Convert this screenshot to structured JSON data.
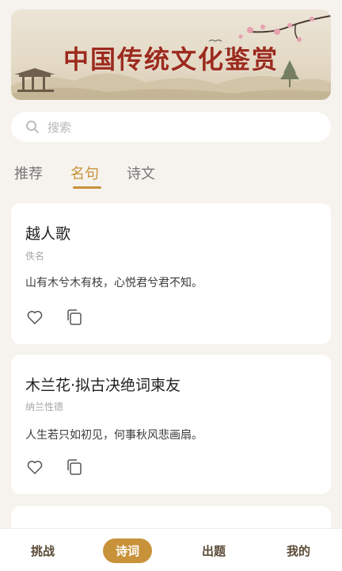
{
  "banner": {
    "title": "中国传统文化鉴赏"
  },
  "search": {
    "placeholder": "搜索",
    "icon": "search-icon"
  },
  "tabs": [
    {
      "label": "推荐",
      "active": false
    },
    {
      "label": "名句",
      "active": true
    },
    {
      "label": "诗文",
      "active": false
    }
  ],
  "cards": [
    {
      "title": "越人歌",
      "author": "佚名",
      "verse": "山有木兮木有枝，心悦君兮君不知。"
    },
    {
      "title": "木兰花·拟古决绝词柬友",
      "author": "纳兰性德",
      "verse": "人生若只如初见，何事秋风悲画扇。"
    }
  ],
  "nav": [
    {
      "label": "挑战",
      "active": false
    },
    {
      "label": "诗词",
      "active": true
    },
    {
      "label": "出题",
      "active": false
    },
    {
      "label": "我的",
      "active": false
    }
  ],
  "colors": {
    "accent": "#c8923a",
    "background": "#f6f3ee",
    "banner_title": "#9c2a1e"
  }
}
